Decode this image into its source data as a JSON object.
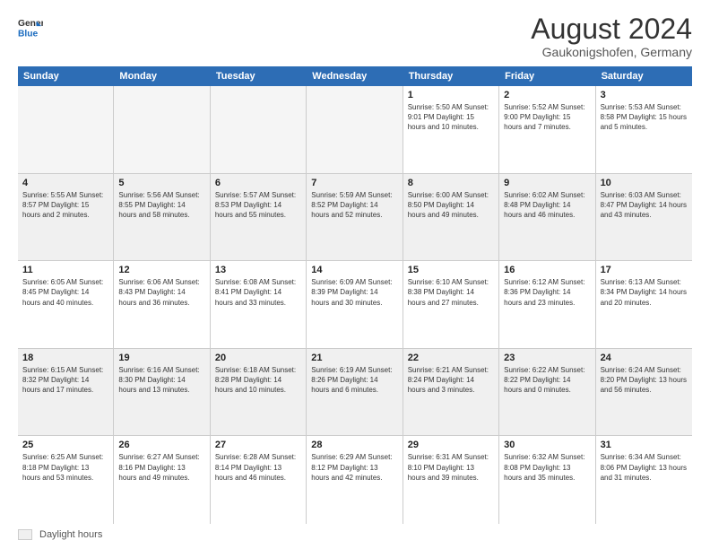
{
  "logo": {
    "general": "General",
    "blue": "Blue"
  },
  "title": "August 2024",
  "location": "Gaukonigshofen, Germany",
  "header_days": [
    "Sunday",
    "Monday",
    "Tuesday",
    "Wednesday",
    "Thursday",
    "Friday",
    "Saturday"
  ],
  "legend_label": "Daylight hours",
  "weeks": [
    [
      {
        "day": "",
        "info": "",
        "empty": true
      },
      {
        "day": "",
        "info": "",
        "empty": true
      },
      {
        "day": "",
        "info": "",
        "empty": true
      },
      {
        "day": "",
        "info": "",
        "empty": true
      },
      {
        "day": "1",
        "info": "Sunrise: 5:50 AM\nSunset: 9:01 PM\nDaylight: 15 hours\nand 10 minutes.",
        "empty": false
      },
      {
        "day": "2",
        "info": "Sunrise: 5:52 AM\nSunset: 9:00 PM\nDaylight: 15 hours\nand 7 minutes.",
        "empty": false
      },
      {
        "day": "3",
        "info": "Sunrise: 5:53 AM\nSunset: 8:58 PM\nDaylight: 15 hours\nand 5 minutes.",
        "empty": false
      }
    ],
    [
      {
        "day": "4",
        "info": "Sunrise: 5:55 AM\nSunset: 8:57 PM\nDaylight: 15 hours\nand 2 minutes.",
        "empty": false
      },
      {
        "day": "5",
        "info": "Sunrise: 5:56 AM\nSunset: 8:55 PM\nDaylight: 14 hours\nand 58 minutes.",
        "empty": false
      },
      {
        "day": "6",
        "info": "Sunrise: 5:57 AM\nSunset: 8:53 PM\nDaylight: 14 hours\nand 55 minutes.",
        "empty": false
      },
      {
        "day": "7",
        "info": "Sunrise: 5:59 AM\nSunset: 8:52 PM\nDaylight: 14 hours\nand 52 minutes.",
        "empty": false
      },
      {
        "day": "8",
        "info": "Sunrise: 6:00 AM\nSunset: 8:50 PM\nDaylight: 14 hours\nand 49 minutes.",
        "empty": false
      },
      {
        "day": "9",
        "info": "Sunrise: 6:02 AM\nSunset: 8:48 PM\nDaylight: 14 hours\nand 46 minutes.",
        "empty": false
      },
      {
        "day": "10",
        "info": "Sunrise: 6:03 AM\nSunset: 8:47 PM\nDaylight: 14 hours\nand 43 minutes.",
        "empty": false
      }
    ],
    [
      {
        "day": "11",
        "info": "Sunrise: 6:05 AM\nSunset: 8:45 PM\nDaylight: 14 hours\nand 40 minutes.",
        "empty": false
      },
      {
        "day": "12",
        "info": "Sunrise: 6:06 AM\nSunset: 8:43 PM\nDaylight: 14 hours\nand 36 minutes.",
        "empty": false
      },
      {
        "day": "13",
        "info": "Sunrise: 6:08 AM\nSunset: 8:41 PM\nDaylight: 14 hours\nand 33 minutes.",
        "empty": false
      },
      {
        "day": "14",
        "info": "Sunrise: 6:09 AM\nSunset: 8:39 PM\nDaylight: 14 hours\nand 30 minutes.",
        "empty": false
      },
      {
        "day": "15",
        "info": "Sunrise: 6:10 AM\nSunset: 8:38 PM\nDaylight: 14 hours\nand 27 minutes.",
        "empty": false
      },
      {
        "day": "16",
        "info": "Sunrise: 6:12 AM\nSunset: 8:36 PM\nDaylight: 14 hours\nand 23 minutes.",
        "empty": false
      },
      {
        "day": "17",
        "info": "Sunrise: 6:13 AM\nSunset: 8:34 PM\nDaylight: 14 hours\nand 20 minutes.",
        "empty": false
      }
    ],
    [
      {
        "day": "18",
        "info": "Sunrise: 6:15 AM\nSunset: 8:32 PM\nDaylight: 14 hours\nand 17 minutes.",
        "empty": false
      },
      {
        "day": "19",
        "info": "Sunrise: 6:16 AM\nSunset: 8:30 PM\nDaylight: 14 hours\nand 13 minutes.",
        "empty": false
      },
      {
        "day": "20",
        "info": "Sunrise: 6:18 AM\nSunset: 8:28 PM\nDaylight: 14 hours\nand 10 minutes.",
        "empty": false
      },
      {
        "day": "21",
        "info": "Sunrise: 6:19 AM\nSunset: 8:26 PM\nDaylight: 14 hours\nand 6 minutes.",
        "empty": false
      },
      {
        "day": "22",
        "info": "Sunrise: 6:21 AM\nSunset: 8:24 PM\nDaylight: 14 hours\nand 3 minutes.",
        "empty": false
      },
      {
        "day": "23",
        "info": "Sunrise: 6:22 AM\nSunset: 8:22 PM\nDaylight: 14 hours\nand 0 minutes.",
        "empty": false
      },
      {
        "day": "24",
        "info": "Sunrise: 6:24 AM\nSunset: 8:20 PM\nDaylight: 13 hours\nand 56 minutes.",
        "empty": false
      }
    ],
    [
      {
        "day": "25",
        "info": "Sunrise: 6:25 AM\nSunset: 8:18 PM\nDaylight: 13 hours\nand 53 minutes.",
        "empty": false
      },
      {
        "day": "26",
        "info": "Sunrise: 6:27 AM\nSunset: 8:16 PM\nDaylight: 13 hours\nand 49 minutes.",
        "empty": false
      },
      {
        "day": "27",
        "info": "Sunrise: 6:28 AM\nSunset: 8:14 PM\nDaylight: 13 hours\nand 46 minutes.",
        "empty": false
      },
      {
        "day": "28",
        "info": "Sunrise: 6:29 AM\nSunset: 8:12 PM\nDaylight: 13 hours\nand 42 minutes.",
        "empty": false
      },
      {
        "day": "29",
        "info": "Sunrise: 6:31 AM\nSunset: 8:10 PM\nDaylight: 13 hours\nand 39 minutes.",
        "empty": false
      },
      {
        "day": "30",
        "info": "Sunrise: 6:32 AM\nSunset: 8:08 PM\nDaylight: 13 hours\nand 35 minutes.",
        "empty": false
      },
      {
        "day": "31",
        "info": "Sunrise: 6:34 AM\nSunset: 8:06 PM\nDaylight: 13 hours\nand 31 minutes.",
        "empty": false
      }
    ]
  ]
}
